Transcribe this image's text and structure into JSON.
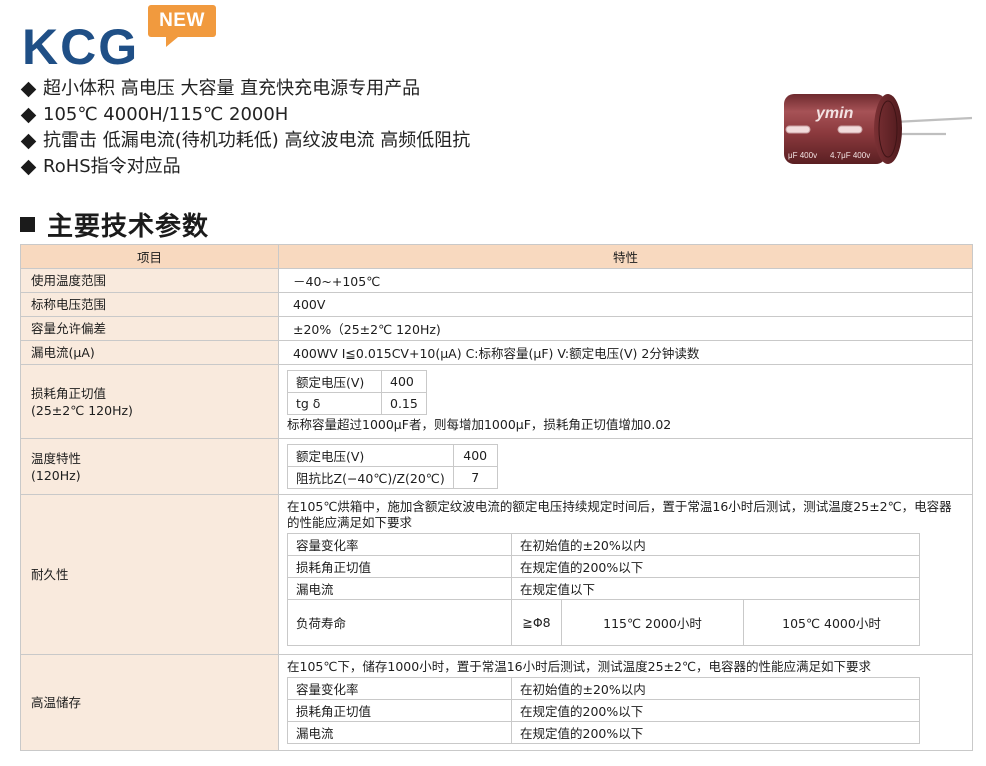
{
  "header": {
    "brand": "KCG",
    "badge": "NEW",
    "features": [
      "超小体积 高电压 大容量 直充快充电源专用产品",
      "105℃ 4000H/115℃ 2000H",
      "抗雷击 低漏电流(待机功耗低) 高纹波电流 高频低阻抗",
      "RoHS指令对应品"
    ]
  },
  "product_image": {
    "brand_print": "ymin",
    "marking_1": "μF 400v",
    "marking_2": "4.7μF 400v",
    "colors": {
      "sleeve": "#8c3a3e",
      "band": "#c9a0a2",
      "lead": "#bfbfbf"
    }
  },
  "section": {
    "title": "主要技术参数"
  },
  "table": {
    "headers": [
      "项目",
      "特性"
    ],
    "rows": {
      "temp_range": {
        "label": "使用温度范围",
        "value": "－40~+105℃"
      },
      "voltage_range": {
        "label": "标称电压范围",
        "value": "400V"
      },
      "cap_tolerance": {
        "label": "容量允许偏差",
        "value": "±20%（25±2℃ 120Hz)"
      },
      "leakage": {
        "label": "漏电流(μA)",
        "value": "400WV I≦0.015CV+10(μA) C:标称容量(μF) V:额定电压(V) 2分钟读数"
      },
      "tan_delta": {
        "label_1": "损耗角正切值",
        "label_2": "(25±2℃ 120Hz)",
        "inner": [
          [
            "额定电压(V)",
            "400"
          ],
          [
            "tg δ",
            "0.15"
          ]
        ],
        "note": "标称容量超过1000μF者，则每增加1000μF，损耗角正切值增加0.02"
      },
      "temp_char": {
        "label_1": "温度特性",
        "label_2": "(120Hz)",
        "inner": [
          [
            "额定电压(V)",
            "400"
          ],
          [
            "阻抗比Z(−40℃)/Z(20℃)",
            "7"
          ]
        ]
      },
      "endurance": {
        "label": "耐久性",
        "desc": "在105℃烘箱中，施加含额定纹波电流的额定电压持续规定时间后，置于常温16小时后测试，测试温度25±2℃，电容器的性能应满足如下要求",
        "items": [
          [
            "容量变化率",
            "在初始值的±20%以内"
          ],
          [
            "损耗角正切值",
            "在规定值的200%以下"
          ],
          [
            "漏电流",
            "在规定值以下"
          ]
        ],
        "load_life": {
          "label": "负荷寿命",
          "size": "≧Φ8",
          "life_115": "115℃ 2000小时",
          "life_105": "105℃ 4000小时"
        }
      },
      "storage": {
        "label": "高温储存",
        "desc": "在105℃下，储存1000小时，置于常温16小时后测试，测试温度25±2℃，电容器的性能应满足如下要求",
        "items": [
          [
            "容量变化率",
            "在初始值的±20%以内"
          ],
          [
            "损耗角正切值",
            "在规定值的200%以下"
          ],
          [
            "漏电流",
            "在规定值的200%以下"
          ]
        ]
      }
    }
  }
}
